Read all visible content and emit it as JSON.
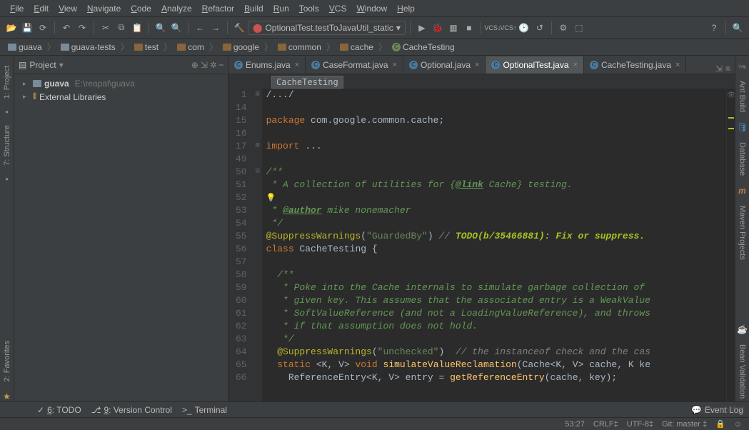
{
  "menu": [
    "File",
    "Edit",
    "View",
    "Navigate",
    "Code",
    "Analyze",
    "Refactor",
    "Build",
    "Run",
    "Tools",
    "VCS",
    "Window",
    "Help"
  ],
  "run_config": {
    "label": "OptionalTest.testToJavaUtil_static"
  },
  "breadcrumbs": [
    {
      "icon": "module",
      "label": "guava"
    },
    {
      "icon": "module",
      "label": "guava-tests"
    },
    {
      "icon": "folder",
      "label": "test"
    },
    {
      "icon": "folder",
      "label": "com"
    },
    {
      "icon": "folder",
      "label": "google"
    },
    {
      "icon": "folder",
      "label": "common"
    },
    {
      "icon": "folder",
      "label": "cache"
    },
    {
      "icon": "class",
      "label": "CacheTesting"
    }
  ],
  "project_panel": {
    "title": "Project",
    "tree": [
      {
        "name": "guava",
        "path": "E:\\reapal\\guava",
        "bold": true,
        "icon": "module"
      },
      {
        "name": "External Libraries",
        "icon": "lib"
      }
    ]
  },
  "tabs": [
    {
      "label": "Enums.java",
      "icon": "class"
    },
    {
      "label": "CaseFormat.java",
      "icon": "class"
    },
    {
      "label": "Optional.java",
      "icon": "class"
    },
    {
      "label": "OptionalTest.java",
      "icon": "class",
      "active": true
    },
    {
      "label": "CacheTesting.java",
      "icon": "class"
    }
  ],
  "editor_breadcrumb": "CacheTesting",
  "code": {
    "line_numbers": [
      1,
      14,
      15,
      16,
      17,
      49,
      50,
      51,
      52,
      53,
      54,
      55,
      56,
      57,
      58,
      59,
      60,
      61,
      62,
      63,
      64,
      65,
      66
    ],
    "lines": [
      {
        "t": "fold",
        "html": "/.../"
      },
      {
        "t": "blank"
      },
      {
        "t": "pkg",
        "html": "<span class='kw'>package</span> com.google.common.cache<span class='punct'>;</span>"
      },
      {
        "t": "blank"
      },
      {
        "t": "imp",
        "html": "<span class='kw'>import</span> <span class='punct'>...</span>"
      },
      {
        "t": "blank"
      },
      {
        "t": "doc",
        "html": "<span class='doc'>/**</span>"
      },
      {
        "t": "doc",
        "html": "<span class='doc'> * A collection of utilities for {</span><span class='doctag'>@link</span><span class='doc'> Cache} testing.</span>"
      },
      {
        "t": "bulb",
        "html": "<span class='bulb'>💡</span>"
      },
      {
        "t": "doc",
        "html": "<span class='doc'> * </span><span class='doctag'>@author</span><span class='doc'> mike nonemacher</span>"
      },
      {
        "t": "doc",
        "html": "<span class='doc'> */</span>"
      },
      {
        "t": "code",
        "html": "<span class='ann'>@SuppressWarnings</span>(<span class='str'>\"GuardedBy\"</span>) <span class='cmt'>// </span><span class='todo'>TODO(b/35466881): Fix or suppress.</span>"
      },
      {
        "t": "code",
        "html": "<span class='kw'>class</span> CacheTesting <span class='punct'>{</span>"
      },
      {
        "t": "blank"
      },
      {
        "t": "doc",
        "html": "  <span class='doc'>/**</span>"
      },
      {
        "t": "doc",
        "html": "  <span class='doc'> * Poke into the Cache internals to simulate garbage collection of</span>"
      },
      {
        "t": "doc",
        "html": "  <span class='doc'> * given key. This assumes that the associated entry is a WeakValue</span>"
      },
      {
        "t": "doc",
        "html": "  <span class='doc'> * SoftValueReference (and not a LoadingValueReference), and throws</span>"
      },
      {
        "t": "doc",
        "html": "  <span class='doc'> * if that assumption does not hold.</span>"
      },
      {
        "t": "doc",
        "html": "  <span class='doc'> */</span>"
      },
      {
        "t": "code",
        "html": "  <span class='ann'>@SuppressWarnings</span>(<span class='str'>\"unchecked\"</span>)  <span class='cmt'>// the instanceof check and the cas</span>"
      },
      {
        "t": "code",
        "html": "  <span class='kw'>static</span> &lt;<span class='type'>K</span>, <span class='type'>V</span>&gt; <span class='kw'>void</span> <span class='fn'>simulateValueReclamation</span>(Cache&lt;<span class='type'>K</span>, <span class='type'>V</span>&gt; cache, <span class='type'>K</span> ke"
      },
      {
        "t": "code",
        "html": "    ReferenceEntry&lt;<span class='type'>K</span>, <span class='type'>V</span>&gt; entry = <span class='fn'>getReferenceEntry</span>(cache, key);"
      }
    ]
  },
  "left_tabs": [
    "1: Project",
    "7: Structure",
    "2: Favorites"
  ],
  "right_tabs": [
    "Ant Build",
    "Database",
    "Maven Projects",
    "Bean Validation"
  ],
  "bottom_tools": [
    {
      "num": "6",
      "label": "TODO",
      "icon": "✓"
    },
    {
      "num": "9",
      "label": "Version Control",
      "icon": "⎇"
    },
    {
      "label": "Terminal",
      "icon": ">_"
    }
  ],
  "event_log": "Event Log",
  "status": {
    "pos": "53:27",
    "sep": "CRLF",
    "sep_arrow": "‡",
    "enc": "UTF-8",
    "enc_arrow": "‡",
    "git": "Git: master",
    "git_arrow": "‡"
  }
}
